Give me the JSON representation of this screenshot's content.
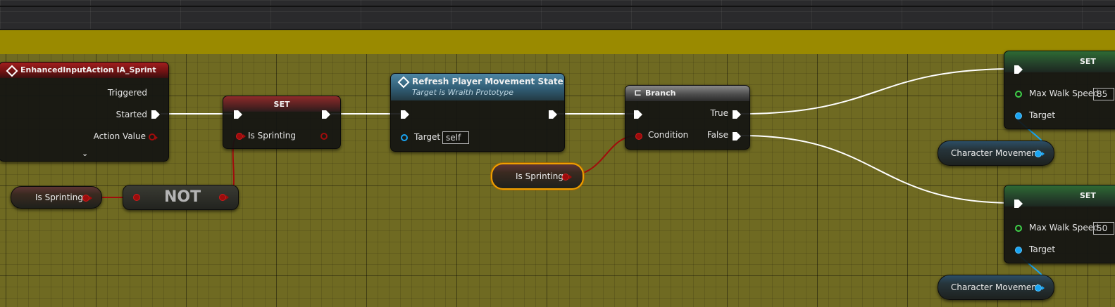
{
  "event_node": {
    "title": "EnhancedInputAction IA_Sprint",
    "pins": [
      "Triggered",
      "Started",
      "Action Value"
    ],
    "expand_icon": "chevron-down-icon",
    "header_color": "#8c1a1a"
  },
  "set_bool_node": {
    "title": "SET",
    "pin_label": "Is Sprinting"
  },
  "get_var_left": {
    "label": "Is Sprinting"
  },
  "not_node": {
    "label": "NOT"
  },
  "refresh_node": {
    "title": "Refresh Player Movement State",
    "subtitle": "Target is Wraith Prototype",
    "target_label": "Target",
    "target_value": "self",
    "header_color": "#3f6f88"
  },
  "get_var_selected": {
    "label": "Is Sprinting"
  },
  "branch_node": {
    "title": "Branch",
    "true_label": "True",
    "false_label": "False",
    "condition_label": "Condition"
  },
  "set_speed_true": {
    "title": "SET",
    "speed_label": "Max Walk Speed",
    "speed_value": "85",
    "target_label": "Target"
  },
  "set_speed_false": {
    "title": "SET",
    "speed_label": "Max Walk Speed",
    "speed_value": "50",
    "target_label": "Target"
  },
  "char_move_top": {
    "label": "Character Movement"
  },
  "char_move_bottom": {
    "label": "Character Movement"
  },
  "colors": {
    "background": "#6f6a22",
    "comment_band": "#9a8a00",
    "exec_wire": "#ffffff",
    "bool_wire": "#a00c0c",
    "object_wire": "#19a4f2",
    "float_pin": "#3fd24a",
    "selection_outline": "#f0a000"
  }
}
